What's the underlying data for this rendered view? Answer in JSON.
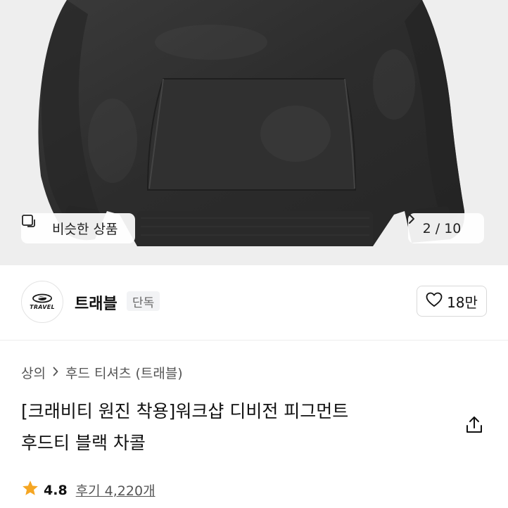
{
  "product_image": {
    "similar_label": "비슷한 상품",
    "counter": "2 / 10"
  },
  "brand": {
    "logo_text": "TRAVEL",
    "name": "트래블",
    "badge": "단독",
    "likes": "18만"
  },
  "breadcrumb": {
    "category": "상의",
    "subcategory": "후드 티셔츠 (트래블)"
  },
  "title": {
    "line1": "[크래비티 원진 착용]워크샵 디비전 피그먼트",
    "line2": "후드티 블랙 차콜"
  },
  "rating": {
    "score": "4.8",
    "reviews": "후기 4,220개"
  },
  "colors": {
    "star": "#f5a623",
    "hoodie": "#2e2e2e",
    "background": "#eeeeee"
  },
  "icons": [
    "similar-products-icon",
    "chevron-right-icon",
    "heart-icon",
    "share-icon",
    "star-icon"
  ]
}
